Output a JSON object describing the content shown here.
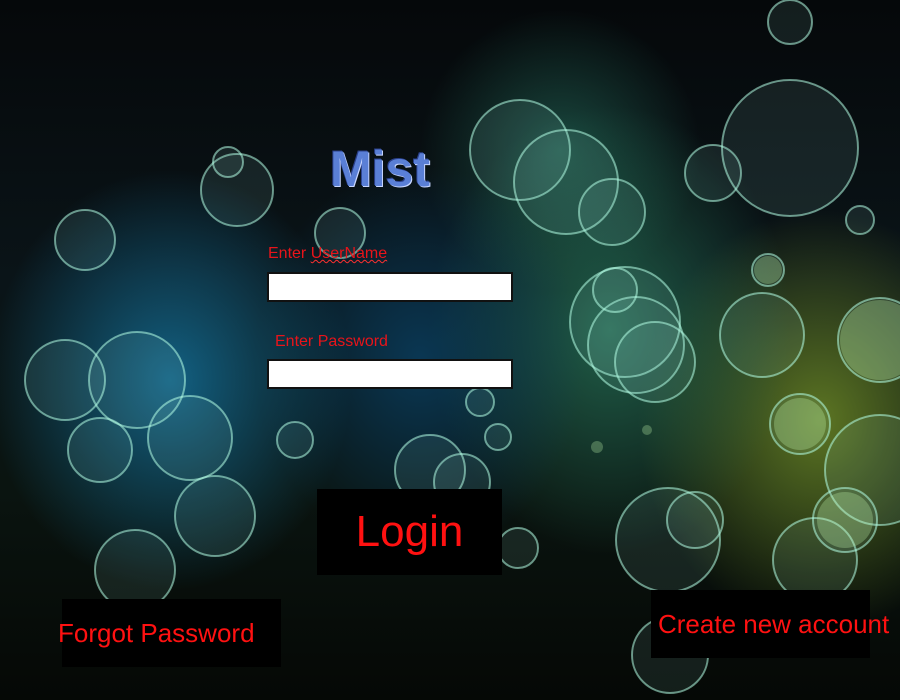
{
  "app": {
    "logo_text": "Mist"
  },
  "form": {
    "username_label_prefix": "Enter ",
    "username_label_word": "UserName",
    "username_value": "",
    "password_label": "Enter Password",
    "password_value": ""
  },
  "actions": {
    "login_label": "Login",
    "forgot_label": "Forgot Password",
    "create_label": "Create new account"
  },
  "colors": {
    "accent_text": "#e8141a",
    "button_bg": "#000000",
    "logo": "#5a7fd6"
  }
}
